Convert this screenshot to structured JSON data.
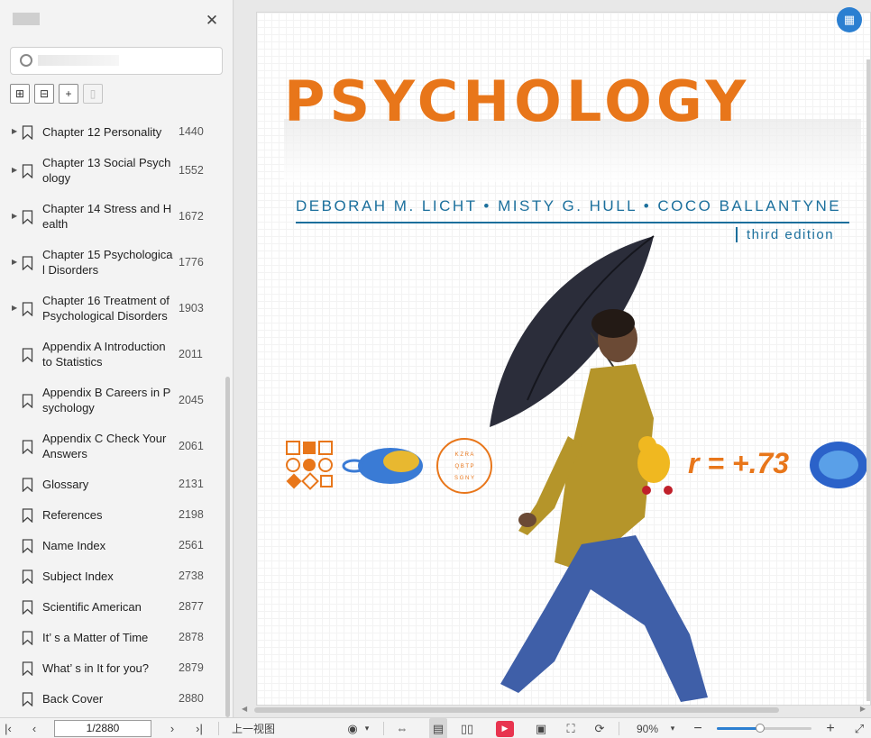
{
  "sidebar": {
    "tools": [
      "expand-all",
      "collapse-all",
      "add-bookmark",
      "remove-bookmark"
    ],
    "items": [
      {
        "label": "Chapter 12 Personality",
        "page": "1440",
        "has_children": true
      },
      {
        "label": "Chapter 13 Social Psych ology",
        "page": "1552",
        "has_children": true
      },
      {
        "label": "Chapter 14 Stress and H ealth",
        "page": "1672",
        "has_children": true
      },
      {
        "label": "Chapter 15 Psychologica l Disorders",
        "page": "1776",
        "has_children": true
      },
      {
        "label": "Chapter 16 Treatment of Psychological Disorders",
        "page": "1903",
        "has_children": true
      },
      {
        "label": "Appendix A Introduction to Statistics",
        "page": "2011",
        "has_children": false
      },
      {
        "label": "Appendix B Careers in P sychology",
        "page": "2045",
        "has_children": false
      },
      {
        "label": "Appendix C Check Your Answers",
        "page": "2061",
        "has_children": false
      },
      {
        "label": "Glossary",
        "page": "2131",
        "has_children": false
      },
      {
        "label": "References",
        "page": "2198",
        "has_children": false
      },
      {
        "label": "Name Index",
        "page": "2561",
        "has_children": false
      },
      {
        "label": "Subject Index",
        "page": "2738",
        "has_children": false
      },
      {
        "label": "Scientific American",
        "page": "2877",
        "has_children": false
      },
      {
        "label": "It’ s a Matter of Time",
        "page": "2878",
        "has_children": false
      },
      {
        "label": "What’ s in It for you?",
        "page": "2879",
        "has_children": false
      },
      {
        "label": "Back Cover",
        "page": "2880",
        "has_children": false
      }
    ]
  },
  "cover": {
    "title": "PSYCHOLOGY",
    "authors": "DEBORAH M. LICHT  •  MISTY G. HULL  •  COCO BALLANTYNE",
    "edition": "third edition",
    "r_value": "r = +.73",
    "eye_chart": [
      "K Z R A",
      "Q B T P",
      "S G N Y"
    ],
    "accent_color": "#e8761a",
    "author_color": "#1b6f9c"
  },
  "bottombar": {
    "page_value": "1/2880",
    "prev_view": "上一视图",
    "zoom": "90%",
    "zoom_fraction": 0.46
  }
}
